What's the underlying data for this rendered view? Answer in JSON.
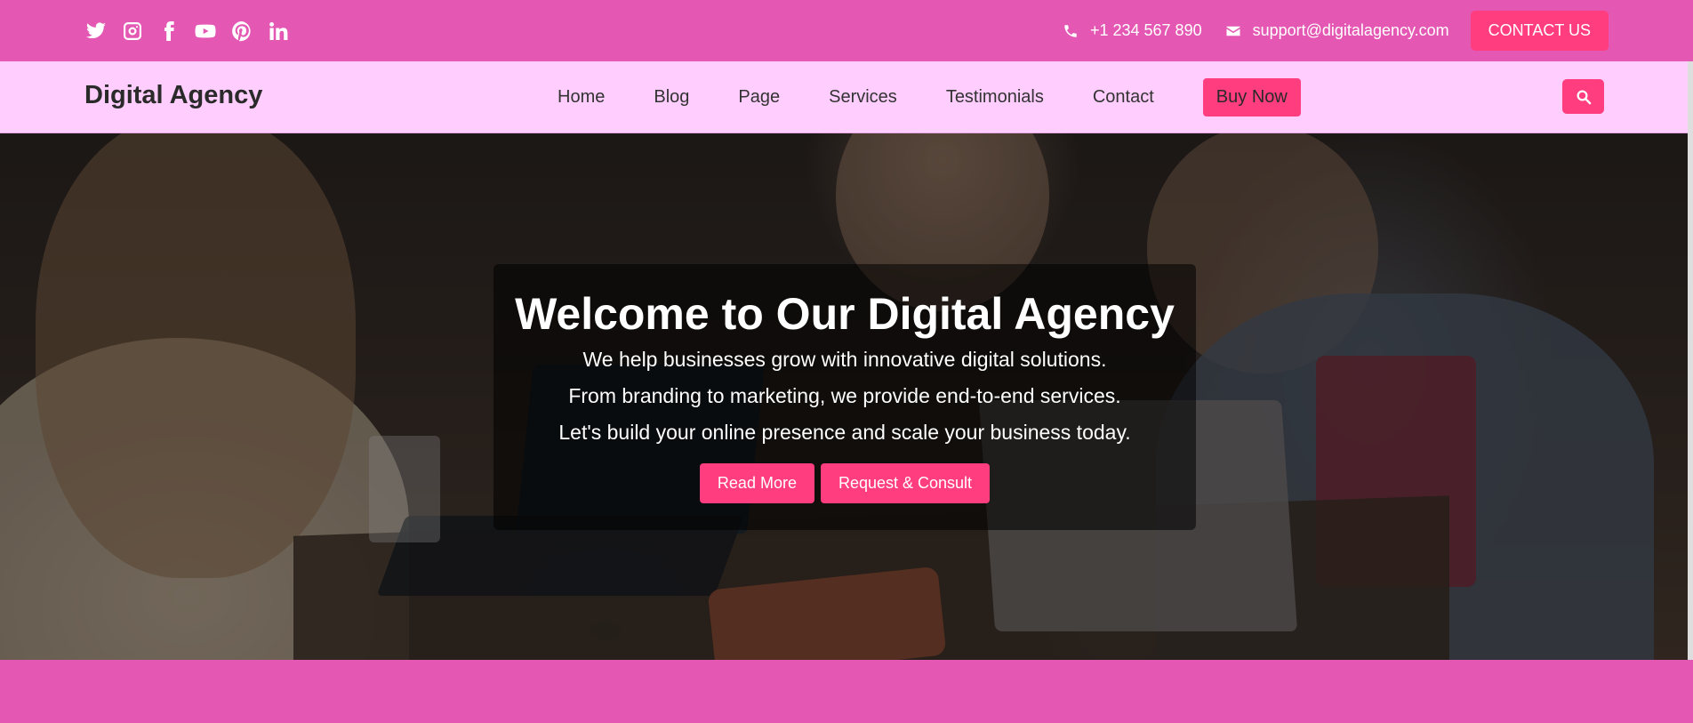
{
  "topbar": {
    "socials": [
      {
        "icon": "twitter-icon"
      },
      {
        "icon": "instagram-icon"
      },
      {
        "icon": "facebook-icon"
      },
      {
        "icon": "youtube-icon"
      },
      {
        "icon": "pinterest-icon"
      },
      {
        "icon": "linkedin-icon"
      }
    ],
    "phone": "+1 234 567 890",
    "email": "support@digitalagency.com",
    "contact_button": "CONTACT US"
  },
  "nav": {
    "brand": "Digital Agency",
    "links": [
      "Home",
      "Blog",
      "Page",
      "Services",
      "Testimonials",
      "Contact"
    ],
    "buy_button": "Buy Now",
    "search_icon": "search-icon"
  },
  "hero": {
    "title": "Welcome to Our Digital Agency",
    "lines": [
      "We help businesses grow with innovative digital solutions.",
      "From branding to marketing, we provide end-to-end services.",
      "Let's build your online presence and scale your business today."
    ],
    "buttons": [
      "Read More",
      "Request & Consult"
    ]
  },
  "colors": {
    "topbar_bg": "#e458b4",
    "navbar_bg": "#ffcdfe",
    "accent": "#ff3d7f",
    "text_dark": "#2a2a2a"
  }
}
